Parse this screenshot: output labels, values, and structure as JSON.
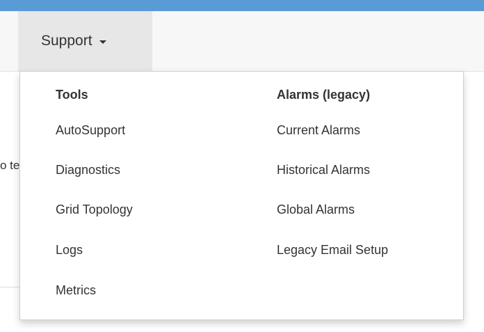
{
  "nav": {
    "support_label": "Support"
  },
  "background": {
    "partial_text": "o te"
  },
  "dropdown": {
    "tools": {
      "header": "Tools",
      "items": [
        "AutoSupport",
        "Diagnostics",
        "Grid Topology",
        "Logs",
        "Metrics"
      ]
    },
    "alarms": {
      "header": "Alarms (legacy)",
      "items": [
        "Current Alarms",
        "Historical Alarms",
        "Global Alarms",
        "Legacy Email Setup"
      ]
    }
  },
  "colors": {
    "accent_bar": "#5b9bd5",
    "navbar_bg": "#f7f7f7",
    "active_tab_bg": "#e7e7e7",
    "text": "#333333"
  }
}
